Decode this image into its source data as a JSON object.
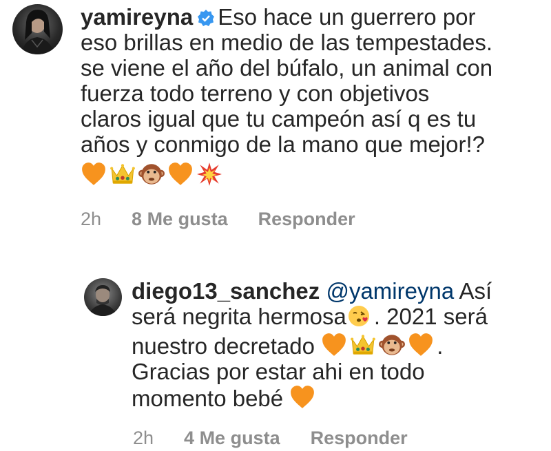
{
  "comments": [
    {
      "username": "yamireyna",
      "verified": true,
      "lines": [
        "Eso hace un guerrero por",
        "eso brillas en medio de las tempestades.",
        "se viene el año del búfalo, un animal con",
        "fuerza todo terreno y con objetivos",
        "claros igual que tu campeón así q es tu",
        "años y conmigo de la mano que mejor!?"
      ],
      "emojis": [
        "orange-heart",
        "crown",
        "monkey-face",
        "orange-heart",
        "collision"
      ],
      "time": "2h",
      "likes": "8 Me gusta",
      "reply": "Responder"
    },
    {
      "username": "diego13_sanchez",
      "mention": "@yamireyna",
      "text_after_mention": "Así",
      "line2a": "será negrita hermosa",
      "line2b": ". 2021 será",
      "line3": "nuestro decretado",
      "line3_end": ".",
      "line4": "Gracias por estar ahi en todo",
      "line5": "momento bebé",
      "time": "2h",
      "likes": "4 Me gusta",
      "reply": "Responder"
    }
  ]
}
